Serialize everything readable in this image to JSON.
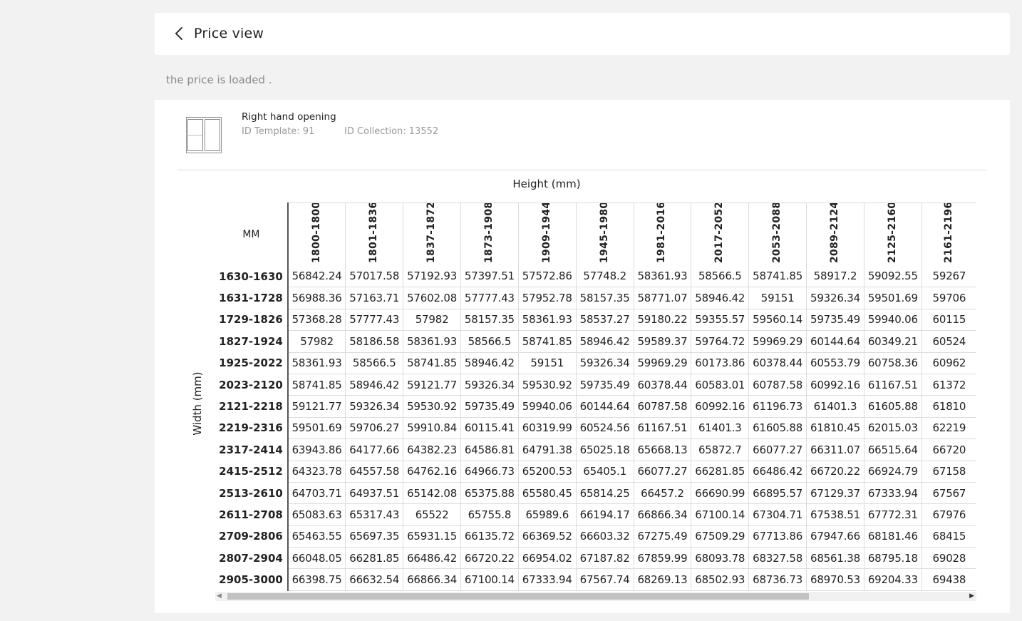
{
  "header": {
    "title": "Price view"
  },
  "status": "the price is loaded .",
  "product": {
    "name": "Right hand opening",
    "template": "ID Template: 91",
    "collection": "ID Collection: 13552"
  },
  "table": {
    "height_label": "Height (mm)",
    "width_label": "Width (mm)",
    "corner": "MM",
    "columns": [
      "1800-1800",
      "1801-1836",
      "1837-1872",
      "1873-1908",
      "1909-1944",
      "1945-1980",
      "1981-2016",
      "2017-2052",
      "2053-2088",
      "2089-2124",
      "2125-2160",
      "2161-2196"
    ],
    "rows": [
      {
        "label": "1630-1630",
        "values": [
          "56842.24",
          "57017.58",
          "57192.93",
          "57397.51",
          "57572.86",
          "57748.2",
          "58361.93",
          "58566.5",
          "58741.85",
          "58917.2",
          "59092.55",
          "59267"
        ]
      },
      {
        "label": "1631-1728",
        "values": [
          "56988.36",
          "57163.71",
          "57602.08",
          "57777.43",
          "57952.78",
          "58157.35",
          "58771.07",
          "58946.42",
          "59151",
          "59326.34",
          "59501.69",
          "59706"
        ]
      },
      {
        "label": "1729-1826",
        "values": [
          "57368.28",
          "57777.43",
          "57982",
          "58157.35",
          "58361.93",
          "58537.27",
          "59180.22",
          "59355.57",
          "59560.14",
          "59735.49",
          "59940.06",
          "60115"
        ]
      },
      {
        "label": "1827-1924",
        "values": [
          "57982",
          "58186.58",
          "58361.93",
          "58566.5",
          "58741.85",
          "58946.42",
          "59589.37",
          "59764.72",
          "59969.29",
          "60144.64",
          "60349.21",
          "60524"
        ]
      },
      {
        "label": "1925-2022",
        "values": [
          "58361.93",
          "58566.5",
          "58741.85",
          "58946.42",
          "59151",
          "59326.34",
          "59969.29",
          "60173.86",
          "60378.44",
          "60553.79",
          "60758.36",
          "60962"
        ]
      },
      {
        "label": "2023-2120",
        "values": [
          "58741.85",
          "58946.42",
          "59121.77",
          "59326.34",
          "59530.92",
          "59735.49",
          "60378.44",
          "60583.01",
          "60787.58",
          "60992.16",
          "61167.51",
          "61372"
        ]
      },
      {
        "label": "2121-2218",
        "values": [
          "59121.77",
          "59326.34",
          "59530.92",
          "59735.49",
          "59940.06",
          "60144.64",
          "60787.58",
          "60992.16",
          "61196.73",
          "61401.3",
          "61605.88",
          "61810"
        ]
      },
      {
        "label": "2219-2316",
        "values": [
          "59501.69",
          "59706.27",
          "59910.84",
          "60115.41",
          "60319.99",
          "60524.56",
          "61167.51",
          "61401.3",
          "61605.88",
          "61810.45",
          "62015.03",
          "62219"
        ]
      },
      {
        "label": "2317-2414",
        "values": [
          "63943.86",
          "64177.66",
          "64382.23",
          "64586.81",
          "64791.38",
          "65025.18",
          "65668.13",
          "65872.7",
          "66077.27",
          "66311.07",
          "66515.64",
          "66720"
        ]
      },
      {
        "label": "2415-2512",
        "values": [
          "64323.78",
          "64557.58",
          "64762.16",
          "64966.73",
          "65200.53",
          "65405.1",
          "66077.27",
          "66281.85",
          "66486.42",
          "66720.22",
          "66924.79",
          "67158"
        ]
      },
      {
        "label": "2513-2610",
        "values": [
          "64703.71",
          "64937.51",
          "65142.08",
          "65375.88",
          "65580.45",
          "65814.25",
          "66457.2",
          "66690.99",
          "66895.57",
          "67129.37",
          "67333.94",
          "67567"
        ]
      },
      {
        "label": "2611-2708",
        "values": [
          "65083.63",
          "65317.43",
          "65522",
          "65755.8",
          "65989.6",
          "66194.17",
          "66866.34",
          "67100.14",
          "67304.71",
          "67538.51",
          "67772.31",
          "67976"
        ]
      },
      {
        "label": "2709-2806",
        "values": [
          "65463.55",
          "65697.35",
          "65931.15",
          "66135.72",
          "66369.52",
          "66603.32",
          "67275.49",
          "67509.29",
          "67713.86",
          "67947.66",
          "68181.46",
          "68415"
        ]
      },
      {
        "label": "2807-2904",
        "values": [
          "66048.05",
          "66281.85",
          "66486.42",
          "66720.22",
          "66954.02",
          "67187.82",
          "67859.99",
          "68093.78",
          "68327.58",
          "68561.38",
          "68795.18",
          "69028"
        ]
      },
      {
        "label": "2905-3000",
        "values": [
          "66398.75",
          "66632.54",
          "66866.34",
          "67100.14",
          "67333.94",
          "67567.74",
          "68269.13",
          "68502.93",
          "68736.73",
          "68970.53",
          "69204.33",
          "69438"
        ]
      }
    ]
  }
}
